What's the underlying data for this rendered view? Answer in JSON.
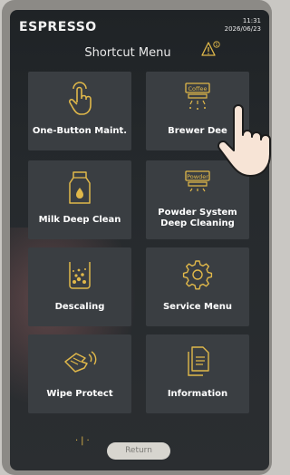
{
  "header": {
    "brand": "ESPRESSO",
    "time": "11:31",
    "date": "2026/06/23"
  },
  "menu": {
    "title": "Shortcut Menu",
    "warning_count": "1"
  },
  "tiles": [
    {
      "label": "One-Button Maint.",
      "icon": "hand-touch-icon"
    },
    {
      "label": "Brewer Dee",
      "icon": "coffee-brewer-icon",
      "icon_text": "Coffee"
    },
    {
      "label": "Milk Deep Clean",
      "icon": "milk-carton-icon"
    },
    {
      "label": "Powder System Deep Cleaning",
      "icon": "powder-dispenser-icon",
      "icon_text": "Powder"
    },
    {
      "label": "Descaling",
      "icon": "descaling-icon"
    },
    {
      "label": "Service Menu",
      "icon": "gear-icon"
    },
    {
      "label": "Wipe Protect",
      "icon": "wipe-hand-icon"
    },
    {
      "label": "Information",
      "icon": "document-icon"
    }
  ],
  "footer": {
    "return_label": "Return"
  },
  "colors": {
    "accent": "#e0b84a",
    "tile": "#3a3e42",
    "screen": "#24282b"
  }
}
